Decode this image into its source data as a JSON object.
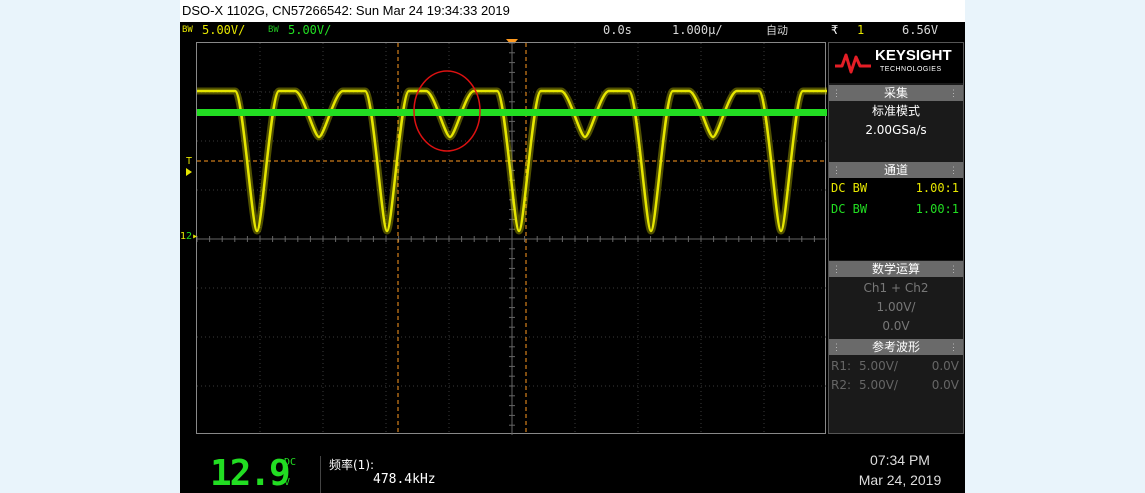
{
  "window": {
    "title": "DSO-X 1102G, CN57266542: Sun Mar 24 19:34:33 2019"
  },
  "status": {
    "ch1_bw": "BW",
    "ch1_scale": "5.00V/",
    "ch2_bw": "BW",
    "ch2_scale": "5.00V/",
    "delay": "0.0s",
    "timebase": "1.000µ/",
    "trigger_mode": "自动",
    "trigger_slope": "₹",
    "trigger_source": "1",
    "trigger_level": "6.56V"
  },
  "brand": {
    "name": "KEYSIGHT",
    "sub": "TECHNOLOGIES"
  },
  "acquire": {
    "title": "采集",
    "mode": "标准模式",
    "rate": "2.00GSa/s"
  },
  "channels": {
    "title": "通道",
    "rows": [
      {
        "label": "DC BW",
        "value": "1.00:1",
        "color": "#e6e600"
      },
      {
        "label": "DC BW",
        "value": "1.00:1",
        "color": "#22dd22"
      }
    ]
  },
  "math": {
    "title": "数学运算",
    "op": "Ch1 + Ch2",
    "scale": "1.00V/",
    "offset": "0.0V"
  },
  "reference": {
    "title": "参考波形",
    "rows": [
      {
        "label": "R1:",
        "scale": "5.00V/",
        "offset": "0.0V"
      },
      {
        "label": "R2:",
        "scale": "5.00V/",
        "offset": "0.0V"
      }
    ]
  },
  "meter": {
    "value": "12.9",
    "mode": "DC",
    "unit": "V"
  },
  "measurement": {
    "label": "频率(1):",
    "value": "478.4kHz"
  },
  "clock": {
    "time": "07:34 PM",
    "date": "Mar 24, 2019"
  },
  "markers": {
    "trigger": "T",
    "ch1": "1",
    "ch2": "2"
  },
  "colors": {
    "ch1": "#e6e600",
    "ch2": "#22dd22",
    "cursor": "#ff9a1f",
    "annotation": "#dd1111"
  }
}
